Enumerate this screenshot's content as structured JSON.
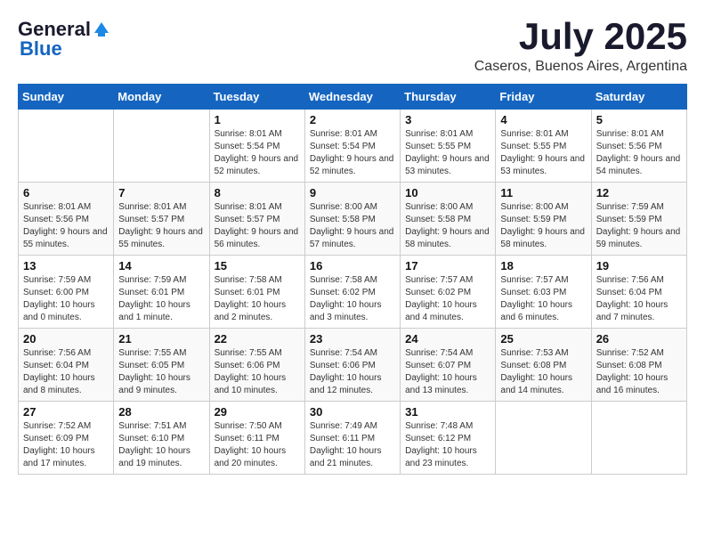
{
  "logo": {
    "general": "General",
    "blue": "Blue"
  },
  "title": "July 2025",
  "subtitle": "Caseros, Buenos Aires, Argentina",
  "days_of_week": [
    "Sunday",
    "Monday",
    "Tuesday",
    "Wednesday",
    "Thursday",
    "Friday",
    "Saturday"
  ],
  "weeks": [
    [
      {
        "day": "",
        "info": ""
      },
      {
        "day": "",
        "info": ""
      },
      {
        "day": "1",
        "info": "Sunrise: 8:01 AM\nSunset: 5:54 PM\nDaylight: 9 hours\nand 52 minutes."
      },
      {
        "day": "2",
        "info": "Sunrise: 8:01 AM\nSunset: 5:54 PM\nDaylight: 9 hours\nand 52 minutes."
      },
      {
        "day": "3",
        "info": "Sunrise: 8:01 AM\nSunset: 5:55 PM\nDaylight: 9 hours\nand 53 minutes."
      },
      {
        "day": "4",
        "info": "Sunrise: 8:01 AM\nSunset: 5:55 PM\nDaylight: 9 hours\nand 53 minutes."
      },
      {
        "day": "5",
        "info": "Sunrise: 8:01 AM\nSunset: 5:56 PM\nDaylight: 9 hours\nand 54 minutes."
      }
    ],
    [
      {
        "day": "6",
        "info": "Sunrise: 8:01 AM\nSunset: 5:56 PM\nDaylight: 9 hours\nand 55 minutes."
      },
      {
        "day": "7",
        "info": "Sunrise: 8:01 AM\nSunset: 5:57 PM\nDaylight: 9 hours\nand 55 minutes."
      },
      {
        "day": "8",
        "info": "Sunrise: 8:01 AM\nSunset: 5:57 PM\nDaylight: 9 hours\nand 56 minutes."
      },
      {
        "day": "9",
        "info": "Sunrise: 8:00 AM\nSunset: 5:58 PM\nDaylight: 9 hours\nand 57 minutes."
      },
      {
        "day": "10",
        "info": "Sunrise: 8:00 AM\nSunset: 5:58 PM\nDaylight: 9 hours\nand 58 minutes."
      },
      {
        "day": "11",
        "info": "Sunrise: 8:00 AM\nSunset: 5:59 PM\nDaylight: 9 hours\nand 58 minutes."
      },
      {
        "day": "12",
        "info": "Sunrise: 7:59 AM\nSunset: 5:59 PM\nDaylight: 9 hours\nand 59 minutes."
      }
    ],
    [
      {
        "day": "13",
        "info": "Sunrise: 7:59 AM\nSunset: 6:00 PM\nDaylight: 10 hours\nand 0 minutes."
      },
      {
        "day": "14",
        "info": "Sunrise: 7:59 AM\nSunset: 6:01 PM\nDaylight: 10 hours\nand 1 minute."
      },
      {
        "day": "15",
        "info": "Sunrise: 7:58 AM\nSunset: 6:01 PM\nDaylight: 10 hours\nand 2 minutes."
      },
      {
        "day": "16",
        "info": "Sunrise: 7:58 AM\nSunset: 6:02 PM\nDaylight: 10 hours\nand 3 minutes."
      },
      {
        "day": "17",
        "info": "Sunrise: 7:57 AM\nSunset: 6:02 PM\nDaylight: 10 hours\nand 4 minutes."
      },
      {
        "day": "18",
        "info": "Sunrise: 7:57 AM\nSunset: 6:03 PM\nDaylight: 10 hours\nand 6 minutes."
      },
      {
        "day": "19",
        "info": "Sunrise: 7:56 AM\nSunset: 6:04 PM\nDaylight: 10 hours\nand 7 minutes."
      }
    ],
    [
      {
        "day": "20",
        "info": "Sunrise: 7:56 AM\nSunset: 6:04 PM\nDaylight: 10 hours\nand 8 minutes."
      },
      {
        "day": "21",
        "info": "Sunrise: 7:55 AM\nSunset: 6:05 PM\nDaylight: 10 hours\nand 9 minutes."
      },
      {
        "day": "22",
        "info": "Sunrise: 7:55 AM\nSunset: 6:06 PM\nDaylight: 10 hours\nand 10 minutes."
      },
      {
        "day": "23",
        "info": "Sunrise: 7:54 AM\nSunset: 6:06 PM\nDaylight: 10 hours\nand 12 minutes."
      },
      {
        "day": "24",
        "info": "Sunrise: 7:54 AM\nSunset: 6:07 PM\nDaylight: 10 hours\nand 13 minutes."
      },
      {
        "day": "25",
        "info": "Sunrise: 7:53 AM\nSunset: 6:08 PM\nDaylight: 10 hours\nand 14 minutes."
      },
      {
        "day": "26",
        "info": "Sunrise: 7:52 AM\nSunset: 6:08 PM\nDaylight: 10 hours\nand 16 minutes."
      }
    ],
    [
      {
        "day": "27",
        "info": "Sunrise: 7:52 AM\nSunset: 6:09 PM\nDaylight: 10 hours\nand 17 minutes."
      },
      {
        "day": "28",
        "info": "Sunrise: 7:51 AM\nSunset: 6:10 PM\nDaylight: 10 hours\nand 19 minutes."
      },
      {
        "day": "29",
        "info": "Sunrise: 7:50 AM\nSunset: 6:11 PM\nDaylight: 10 hours\nand 20 minutes."
      },
      {
        "day": "30",
        "info": "Sunrise: 7:49 AM\nSunset: 6:11 PM\nDaylight: 10 hours\nand 21 minutes."
      },
      {
        "day": "31",
        "info": "Sunrise: 7:48 AM\nSunset: 6:12 PM\nDaylight: 10 hours\nand 23 minutes."
      },
      {
        "day": "",
        "info": ""
      },
      {
        "day": "",
        "info": ""
      }
    ]
  ]
}
